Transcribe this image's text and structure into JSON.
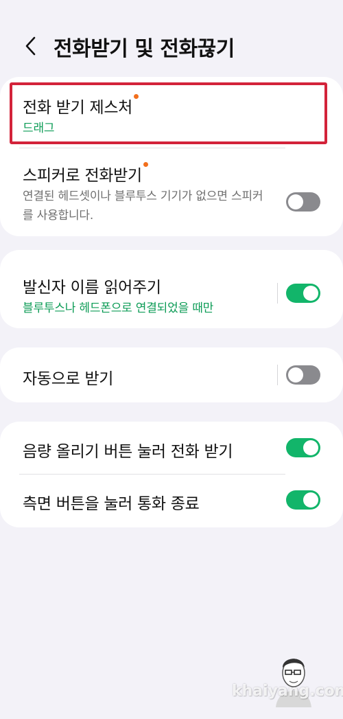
{
  "header": {
    "title": "전화받기 및 전화끊기"
  },
  "card1": {
    "answer_gesture": {
      "title": "전화 받기 제스처",
      "value": "드래그"
    },
    "speaker_answer": {
      "title": "스피커로 전화받기",
      "description": "연결된 헤드셋이나 블루투스 기기가 없으면 스피커를 사용합니다.",
      "enabled": false
    }
  },
  "card2": {
    "read_caller_name": {
      "title": "발신자 이름 읽어주기",
      "subtitle": "블루투스나 헤드폰으로 연결되었을 때만",
      "enabled": true
    }
  },
  "card3": {
    "auto_answer": {
      "title": "자동으로 받기",
      "enabled": false
    }
  },
  "card4": {
    "volume_up_answer": {
      "title": "음량 올리기 버튼 눌러 전화 받기",
      "enabled": true
    },
    "side_button_end": {
      "title": "측면 버튼을 눌러 통화 종료",
      "enabled": true
    }
  },
  "watermark": {
    "text": "khaiyang.com"
  },
  "colors": {
    "accent_green": "#12b56a",
    "subtitle_green": "#0b9b55",
    "new_dot": "#f26f1d",
    "highlight_red": "#d3233a",
    "toggle_off": "#8a8a8e"
  }
}
